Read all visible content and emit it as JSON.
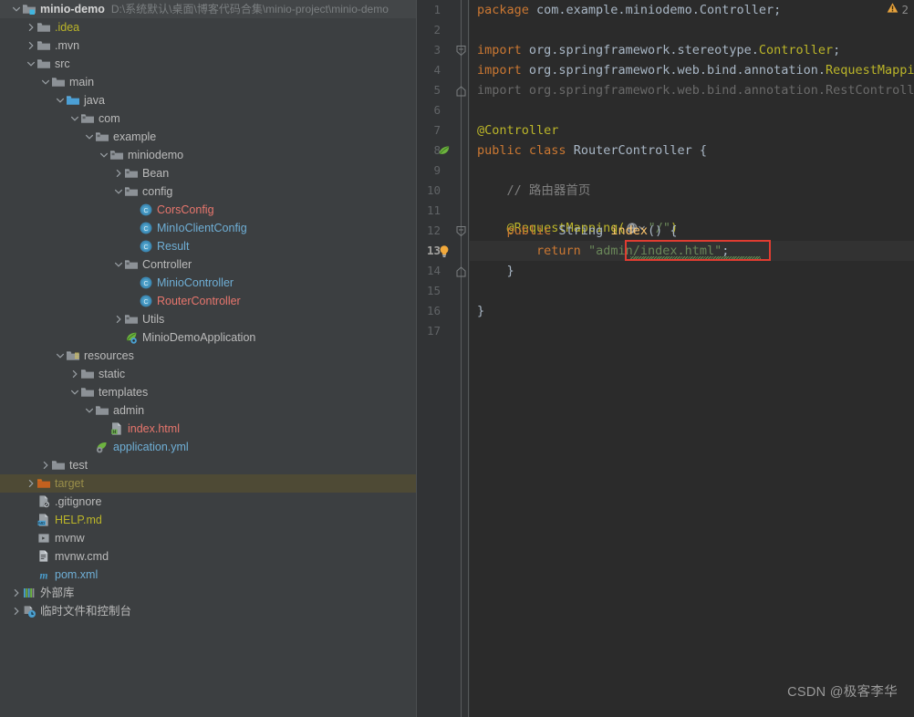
{
  "project": {
    "name": "minio-demo",
    "path": "D:\\系统默认\\桌面\\博客代码合集\\minio-project\\minio-demo"
  },
  "tree": {
    "items": [
      {
        "label": "minio-demo",
        "icon": "module-folder-icon",
        "depth": 0,
        "arrow": "down",
        "style": "bold",
        "header": true
      },
      {
        "label": ".idea",
        "icon": "folder-icon",
        "depth": 1,
        "arrow": "right",
        "style": "ignored"
      },
      {
        "label": ".mvn",
        "icon": "folder-icon",
        "depth": 1,
        "arrow": "right",
        "style": "normal"
      },
      {
        "label": "src",
        "icon": "folder-icon",
        "depth": 1,
        "arrow": "down",
        "style": "normal"
      },
      {
        "label": "main",
        "icon": "folder-icon",
        "depth": 2,
        "arrow": "down",
        "style": "normal"
      },
      {
        "label": "java",
        "icon": "source-root-folder-icon",
        "depth": 3,
        "arrow": "down",
        "style": "normal"
      },
      {
        "label": "com",
        "icon": "package-folder-icon",
        "depth": 4,
        "arrow": "down",
        "style": "normal"
      },
      {
        "label": "example",
        "icon": "package-folder-icon",
        "depth": 5,
        "arrow": "down",
        "style": "normal"
      },
      {
        "label": "miniodemo",
        "icon": "package-folder-icon",
        "depth": 6,
        "arrow": "down",
        "style": "normal"
      },
      {
        "label": "Bean",
        "icon": "package-folder-icon",
        "depth": 7,
        "arrow": "right",
        "style": "normal"
      },
      {
        "label": "config",
        "icon": "package-folder-icon",
        "depth": 7,
        "arrow": "down",
        "style": "normal"
      },
      {
        "label": "CorsConfig",
        "icon": "java-class-icon",
        "depth": 8,
        "arrow": "none",
        "style": "modified"
      },
      {
        "label": "MinIoClientConfig",
        "icon": "java-class-icon",
        "depth": 8,
        "arrow": "none",
        "style": "file"
      },
      {
        "label": "Result",
        "icon": "java-class-icon",
        "depth": 8,
        "arrow": "none",
        "style": "file"
      },
      {
        "label": "Controller",
        "icon": "package-folder-icon",
        "depth": 7,
        "arrow": "down",
        "style": "normal"
      },
      {
        "label": "MinioController",
        "icon": "java-class-icon",
        "depth": 8,
        "arrow": "none",
        "style": "file"
      },
      {
        "label": "RouterController",
        "icon": "java-class-icon",
        "depth": 8,
        "arrow": "none",
        "style": "modified"
      },
      {
        "label": "Utils",
        "icon": "package-folder-icon",
        "depth": 7,
        "arrow": "right",
        "style": "normal"
      },
      {
        "label": "MinioDemoApplication",
        "icon": "spring-boot-icon",
        "depth": 7,
        "arrow": "none",
        "style": "normal"
      },
      {
        "label": "resources",
        "icon": "resource-root-folder-icon",
        "depth": 3,
        "arrow": "down",
        "style": "normal"
      },
      {
        "label": "static",
        "icon": "folder-icon",
        "depth": 4,
        "arrow": "right",
        "style": "normal"
      },
      {
        "label": "templates",
        "icon": "folder-icon",
        "depth": 4,
        "arrow": "down",
        "style": "normal"
      },
      {
        "label": "admin",
        "icon": "folder-icon",
        "depth": 5,
        "arrow": "down",
        "style": "normal"
      },
      {
        "label": "index.html",
        "icon": "html-file-icon",
        "depth": 6,
        "arrow": "none",
        "style": "modified"
      },
      {
        "label": "application.yml",
        "icon": "spring-yaml-icon",
        "depth": 5,
        "arrow": "none",
        "style": "file"
      },
      {
        "label": "test",
        "icon": "folder-icon",
        "depth": 2,
        "arrow": "right",
        "style": "normal"
      },
      {
        "label": "target",
        "icon": "excluded-folder-icon",
        "depth": 1,
        "arrow": "right",
        "style": "excluded",
        "selected": true
      },
      {
        "label": ".gitignore",
        "icon": "gitignore-file-icon",
        "depth": 1,
        "arrow": "none",
        "style": "normal"
      },
      {
        "label": "HELP.md",
        "icon": "markdown-file-icon",
        "depth": 1,
        "arrow": "none",
        "style": "ignored"
      },
      {
        "label": "mvnw",
        "icon": "shell-file-icon",
        "depth": 1,
        "arrow": "none",
        "style": "normal"
      },
      {
        "label": "mvnw.cmd",
        "icon": "cmd-file-icon",
        "depth": 1,
        "arrow": "none",
        "style": "normal"
      },
      {
        "label": "pom.xml",
        "icon": "maven-file-icon",
        "depth": 1,
        "arrow": "none",
        "style": "file"
      },
      {
        "label": "外部库",
        "icon": "external-libraries-icon",
        "depth": 0,
        "arrow": "right",
        "style": "normal"
      },
      {
        "label": "临时文件和控制台",
        "icon": "scratches-icon",
        "depth": 0,
        "arrow": "right",
        "style": "normal"
      }
    ]
  },
  "editor": {
    "warning_count": "2",
    "warning_icon": "warning-triangle-icon",
    "active_line": 13,
    "lines": [
      {
        "n": 1,
        "tokens": [
          {
            "t": "package ",
            "c": "kw"
          },
          {
            "t": "com.example.miniodemo.Controller;",
            "c": "plain"
          }
        ]
      },
      {
        "n": 2,
        "tokens": []
      },
      {
        "n": 3,
        "tokens": [
          {
            "t": "import ",
            "c": "kw"
          },
          {
            "t": "org.springframework.stereotype.",
            "c": "plain"
          },
          {
            "t": "Controller",
            "c": "ann"
          },
          {
            "t": ";",
            "c": "plain"
          }
        ]
      },
      {
        "n": 4,
        "tokens": [
          {
            "t": "import ",
            "c": "kw"
          },
          {
            "t": "org.springframework.web.bind.annotation.",
            "c": "plain"
          },
          {
            "t": "RequestMapping",
            "c": "ann"
          },
          {
            "t": ";",
            "c": "plain"
          }
        ]
      },
      {
        "n": 5,
        "tokens": [
          {
            "t": "import org.springframework.web.bind.annotation.RestController;",
            "c": "grey"
          }
        ]
      },
      {
        "n": 6,
        "tokens": []
      },
      {
        "n": 7,
        "tokens": [
          {
            "t": "@Controller",
            "c": "ann"
          }
        ]
      },
      {
        "n": 8,
        "tokens": [
          {
            "t": "public ",
            "c": "kw"
          },
          {
            "t": "class ",
            "c": "kw"
          },
          {
            "t": "RouterController ",
            "c": "cls"
          },
          {
            "t": "{",
            "c": "punc"
          }
        ]
      },
      {
        "n": 9,
        "tokens": []
      },
      {
        "n": 10,
        "tokens": [
          {
            "t": "    // 路由器首页",
            "c": "cmt"
          }
        ]
      },
      {
        "n": 11,
        "tokens": [
          {
            "t": "    @RequestMapping(",
            "c": "ann"
          },
          {
            "t": "@@GLOBE@@",
            "c": "icon"
          },
          {
            "t": "\"/\"",
            "c": "str"
          },
          {
            "t": ")",
            "c": "ann"
          }
        ]
      },
      {
        "n": 12,
        "tokens": [
          {
            "t": "    ",
            "c": "plain"
          },
          {
            "t": "public ",
            "c": "kw"
          },
          {
            "t": "String ",
            "c": "cls"
          },
          {
            "t": "index",
            "c": "meth"
          },
          {
            "t": "() {",
            "c": "punc"
          }
        ]
      },
      {
        "n": 13,
        "tokens": [
          {
            "t": "        ",
            "c": "plain"
          },
          {
            "t": "return ",
            "c": "kw"
          },
          {
            "t": "\"admin/index.html\"",
            "c": "str"
          },
          {
            "t": ";",
            "c": "punc"
          }
        ]
      },
      {
        "n": 14,
        "tokens": [
          {
            "t": "    }",
            "c": "punc"
          }
        ]
      },
      {
        "n": 15,
        "tokens": []
      },
      {
        "n": 16,
        "tokens": [
          {
            "t": "}",
            "c": "punc"
          }
        ]
      },
      {
        "n": 17,
        "tokens": []
      }
    ],
    "gutter_icons": [
      {
        "line": 8,
        "icon": "spring-bean-icon"
      },
      {
        "line": 13,
        "icon": "intention-bulb-icon"
      }
    ],
    "fold_markers": [
      {
        "line": 3,
        "icon": "fold-collapse-icon"
      },
      {
        "line": 5,
        "icon": "fold-end-icon"
      },
      {
        "line": 12,
        "icon": "fold-collapse-icon"
      },
      {
        "line": 14,
        "icon": "fold-end-icon"
      }
    ],
    "annotation_box": {
      "line": 13,
      "color": "#e03c31"
    }
  },
  "watermark": {
    "text": "CSDN @极客李华"
  },
  "colors": {
    "tree_bg": "#3c3f41",
    "gutter_bg": "#313335",
    "editor_bg": "#2b2b2b",
    "selection_bg": "#4e4a35",
    "keyword": "#cc7832",
    "string": "#6a8759",
    "annotation": "#bbb529",
    "method": "#ffc66d",
    "comment": "#808080",
    "modified_file": "#e8766d",
    "normal_file": "#6fafd6",
    "ignored_file": "#bbb529",
    "excluded_folder": "#9a8f4a",
    "accent_red": "#e03c31"
  }
}
